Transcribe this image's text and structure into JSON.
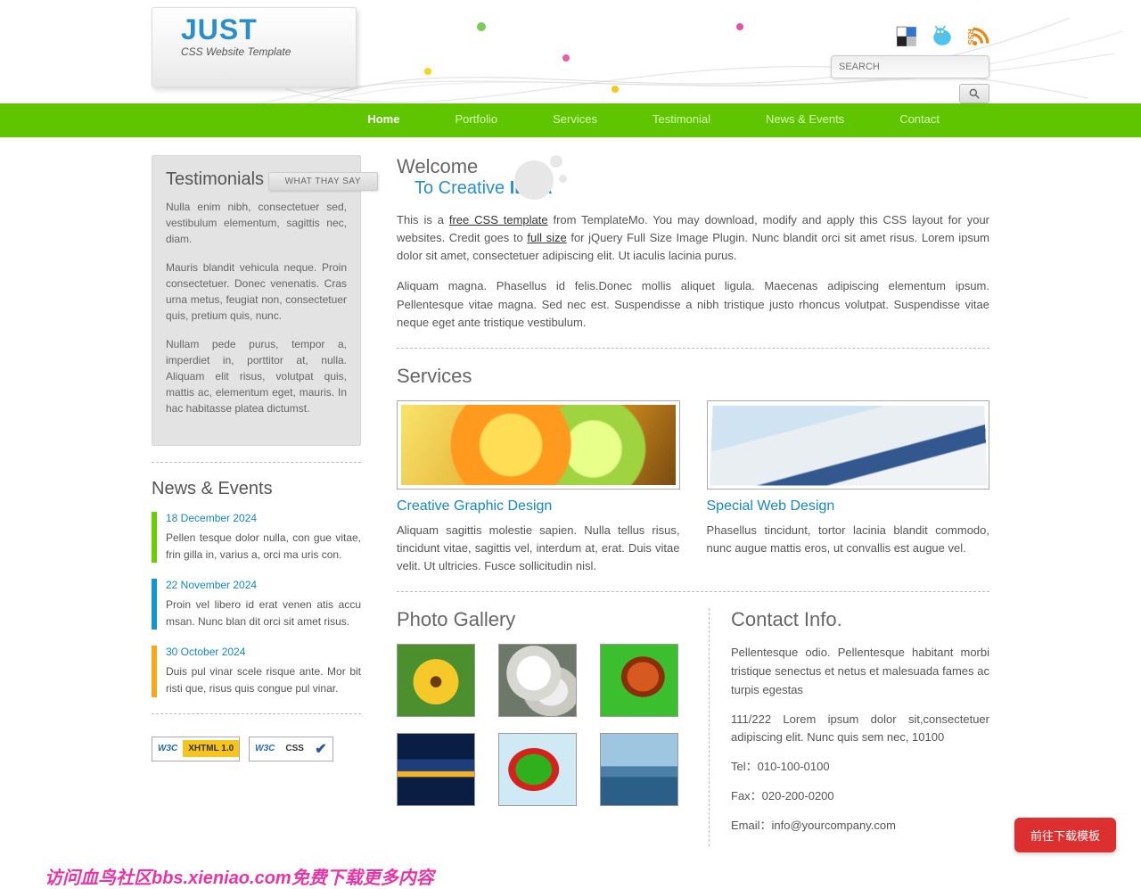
{
  "logo": {
    "brand": "JUST",
    "tag": "CSS Website Template"
  },
  "search": {
    "placeholder": "SEARCH"
  },
  "nav": [
    {
      "label": "Home",
      "active": true
    },
    {
      "label": "Portfolio"
    },
    {
      "label": "Services"
    },
    {
      "label": "Testimonial"
    },
    {
      "label": "News & Events"
    },
    {
      "label": "Contact"
    }
  ],
  "sidebar": {
    "testimonials": {
      "heading": "Testimonials",
      "badge": "WHAT THAY SAY",
      "paras": [
        "Nulla enim nibh, consectetuer sed, vestibulum elementum, sagittis nec, diam.",
        "Mauris blandit vehicula neque. Proin consectetuer. Donec venenatis. Cras urna metus, feugiat non, consectetuer quis, pretium quis, nunc.",
        "Nullam pede purus, tempor a, imperdiet in, porttitor at, nulla. Aliquam elit risus, volutpat quis, mattis ac, elementum eget, mauris. In hac habitasse platea dictumst."
      ]
    },
    "news": {
      "heading": "News & Events",
      "items": [
        {
          "date": "18 December 2024",
          "text": "Pellen tesque dolor nulla, con gue vitae, frin gilla in, varius a, orci ma uris con."
        },
        {
          "date": "22 November 2024",
          "text": "Proin vel libero id erat venen atis accu msan. Nunc blan dit orci sit amet risus."
        },
        {
          "date": "30 October 2024",
          "text": "Duis pul vinar scele risque ante. Mor bit risti que, risus quis congue pul vinar."
        }
      ]
    },
    "validators": [
      {
        "w3c": "W3C",
        "spec": "XHTML 1.0"
      },
      {
        "w3c": "W3C",
        "spec": "CSS"
      }
    ]
  },
  "content": {
    "welcome": {
      "title": "Welcome",
      "sub_prefix": "To Creative ",
      "sub_bold": "IDEA"
    },
    "intro": {
      "p1_pre": "This is a ",
      "p1_link1": "free CSS template",
      "p1_mid": " from TemplateMo. You may download, modify and apply this CSS layout for your websites. Credit goes to ",
      "p1_link2": "full size",
      "p1_post": " for jQuery Full Size Image Plugin. Nunc blandit orci sit amet risus. Lorem ipsum dolor sit amet, consectetuer adipiscing elit. Ut iaculis lacinia purus.",
      "p2": "Aliquam magna. Phasellus id felis.Donec mollis aliquet ligula. Maecenas adipiscing elementum ipsum. Pellentesque vitae magna. Sed nec est. Suspendisse a nibh tristique justo rhoncus volutpat. Suspendisse vitae neque eget ante tristique vestibulum."
    },
    "services": {
      "heading": "Services",
      "items": [
        {
          "title": "Creative Graphic Design",
          "text": "Aliquam sagittis molestie sapien. Nulla tellus risus, tincidunt vitae, sagittis vel, interdum at, erat. Duis vitae velit. Ut ultricies. Fusce sollicitudin nisl."
        },
        {
          "title": "Special Web Design",
          "text": "Phasellus tincidunt, tortor lacinia blandit commodo, nunc augue mattis eros, ut convallis est augue vel."
        }
      ]
    },
    "gallery": {
      "heading": "Photo Gallery"
    },
    "contact": {
      "heading": "Contact Info.",
      "p1": "Pellentesque odio. Pellentesque habitant morbi tristique senectus et netus et malesuada fames ac turpis egestas",
      "p2": "111/222 Lorem ipsum dolor sit,consectetuer adipiscing elit. Nunc quis sem nec, 10100",
      "tel": "Tel：010-100-0100",
      "fax": "Fax：020-200-0200",
      "email": "Email：info@yourcompany.com"
    }
  },
  "footer_ad": "访问血鸟社区bbs.xieniao.com免费下载更多内容",
  "download_btn": "前往下载模板"
}
